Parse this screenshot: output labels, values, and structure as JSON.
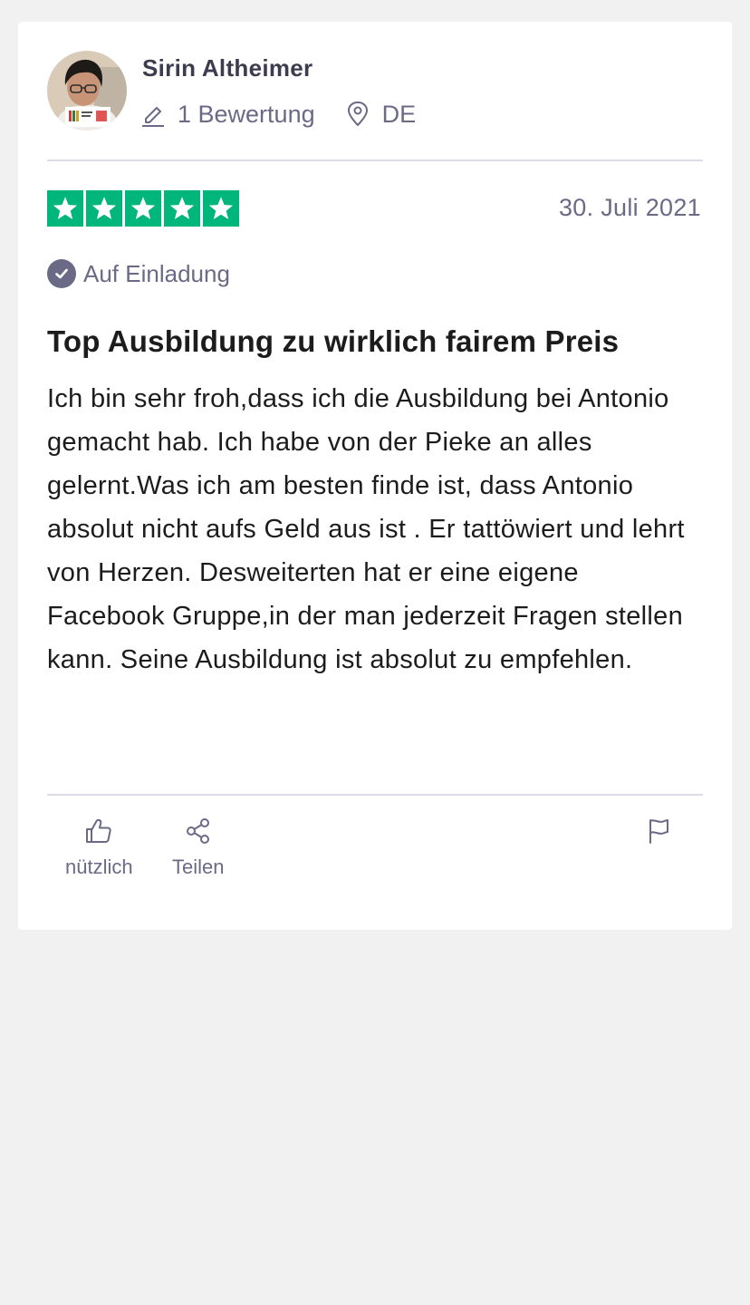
{
  "reviewer": {
    "name": "Sirin Altheimer",
    "review_count": "1 Bewertung",
    "country": "DE"
  },
  "review": {
    "rating": 5,
    "rating_max": 5,
    "date": "30. Juli 2021",
    "invited_label": "Auf Einladung",
    "title": "Top Ausbildung zu wirklich fairem Preis",
    "body": "Ich bin sehr froh,dass ich die Ausbildung bei Antonio gemacht hab. Ich habe von der Pieke an alles gelernt.Was ich am besten finde ist, dass Antonio absolut nicht aufs Geld aus ist . Er tattöwiert und lehrt von Herzen. Desweiterten hat er eine eigene Facebook Gruppe,in der man jederzeit Fragen stellen kann. Seine Ausbildung ist absolut zu empfehlen."
  },
  "actions": {
    "useful_label": "nützlich",
    "share_label": "Teilen"
  },
  "icons": {
    "review_count": "pencil-icon",
    "country": "location-pin-icon",
    "invited": "check-circle-icon",
    "useful": "thumbs-up-icon",
    "share": "share-icon",
    "report": "flag-icon",
    "star": "star-icon"
  },
  "colors": {
    "background": "#f1f1f1",
    "card": "#ffffff",
    "star_green": "#00b67a",
    "muted_text": "#6b6a86",
    "name_text": "#3d3c4e",
    "body_text": "#1c1c1c",
    "divider": "#dcdce6"
  }
}
